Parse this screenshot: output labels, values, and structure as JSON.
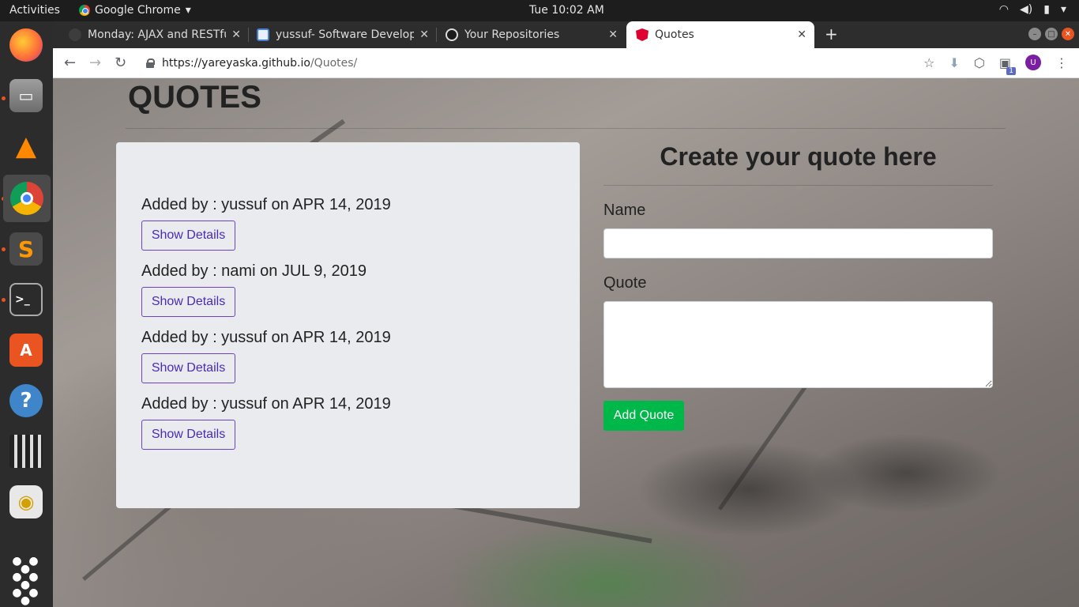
{
  "system": {
    "activities": "Activities",
    "app_name": "Google Chrome",
    "clock": "Tue 10:02 AM"
  },
  "tabs": [
    {
      "title": "Monday: AJAX and RESTfu",
      "active": false
    },
    {
      "title": "yussuf- Software Develop",
      "active": false
    },
    {
      "title": "Your Repositories",
      "active": false
    },
    {
      "title": "Quotes",
      "active": true
    }
  ],
  "address_bar": {
    "host": "https://yareyaska.github.io",
    "path": "/Quotes/"
  },
  "profile": {
    "initial": "U"
  },
  "extension_badge": "1",
  "page": {
    "title": "QUOTES",
    "quotes": [
      {
        "meta": "Added by : yussuf on APR 14, 2019",
        "button": "Show Details"
      },
      {
        "meta": "Added by : nami on JUL 9, 2019",
        "button": "Show Details"
      },
      {
        "meta": "Added by : yussuf on APR 14, 2019",
        "button": "Show Details"
      },
      {
        "meta": "Added by : yussuf on APR 14, 2019",
        "button": "Show Details"
      }
    ],
    "form": {
      "heading": "Create your quote here",
      "name_label": "Name",
      "name_value": "",
      "quote_label": "Quote",
      "quote_value": "",
      "submit_label": "Add Quote"
    }
  },
  "colors": {
    "accent_button_border": "#6f42c1",
    "add_button_bg": "#00b84a",
    "card_bg": "#e9ebef"
  }
}
